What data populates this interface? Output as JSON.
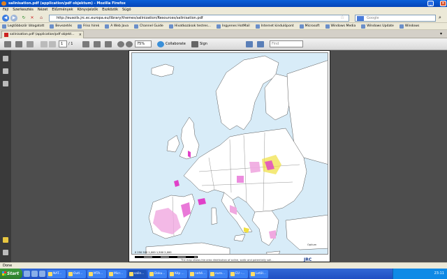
{
  "window": {
    "title": "salinisation.pdf (application/pdf objektum) - Mozilla Firefox"
  },
  "menu": [
    "Fájl",
    "Szerkesztés",
    "Nézet",
    "Előzmények",
    "Könyvjelzők",
    "Eszközök",
    "Súgó"
  ],
  "nav": {
    "url": "http://eusoils.jrc.ec.europa.eu/library/themes/salinization/Resources/salinisation.pdf",
    "search_placeholder": "Google"
  },
  "bookmarks": [
    {
      "label": "Legtöbbször látogatott"
    },
    {
      "label": "Bevezetés"
    },
    {
      "label": "Friss hírek"
    },
    {
      "label": "A Web Java"
    },
    {
      "label": "Channel Guide"
    },
    {
      "label": "Hivatkozások testres..."
    },
    {
      "label": "Ingyenes HotMail"
    },
    {
      "label": "Internet kindulópont"
    },
    {
      "label": "Microsoft"
    },
    {
      "label": "Windows Media"
    },
    {
      "label": "Windows Update"
    },
    {
      "label": "Windows"
    }
  ],
  "tabs": [
    {
      "label": "salinisation.pdf (application/pdf objekt..."
    }
  ],
  "pdf_toolbar": {
    "page_current": "1",
    "page_total": "/ 1",
    "zoom": "75%",
    "collaborate_label": "Collaborate",
    "sign_label": "Sign",
    "find_placeholder": "Find"
  },
  "document": {
    "scale_labels": "0   250   500         1,000         1,500         2,000",
    "caption": "The map shows the area distribution of saline, sodic and potentially sali...",
    "logo_text": "JRC",
    "credit": "Optium"
  },
  "status": {
    "text": "Done"
  },
  "taskbar": {
    "start_label": "Start",
    "tasks": [
      {
        "label": "NAT...",
        "active": false
      },
      {
        "label": "Outl...",
        "active": false
      },
      {
        "label": "MTA...",
        "active": false
      },
      {
        "label": "Micr...",
        "active": false
      },
      {
        "label": "salin...",
        "active": true
      },
      {
        "label": "Doku...",
        "active": false
      },
      {
        "label": "Kép ...",
        "active": false
      },
      {
        "label": "nehé...",
        "active": false
      },
      {
        "label": "euro...",
        "active": false
      },
      {
        "label": "EU -...",
        "active": false
      },
      {
        "label": "Letöl...",
        "active": false
      }
    ],
    "clock": "23:11"
  },
  "colors": {
    "accent": "#0a5fd8",
    "sea": "#d8ecf8",
    "saline_magenta": "#e040c8",
    "saline_pink": "#f0a8e0",
    "saline_yellow": "#f0e040"
  }
}
